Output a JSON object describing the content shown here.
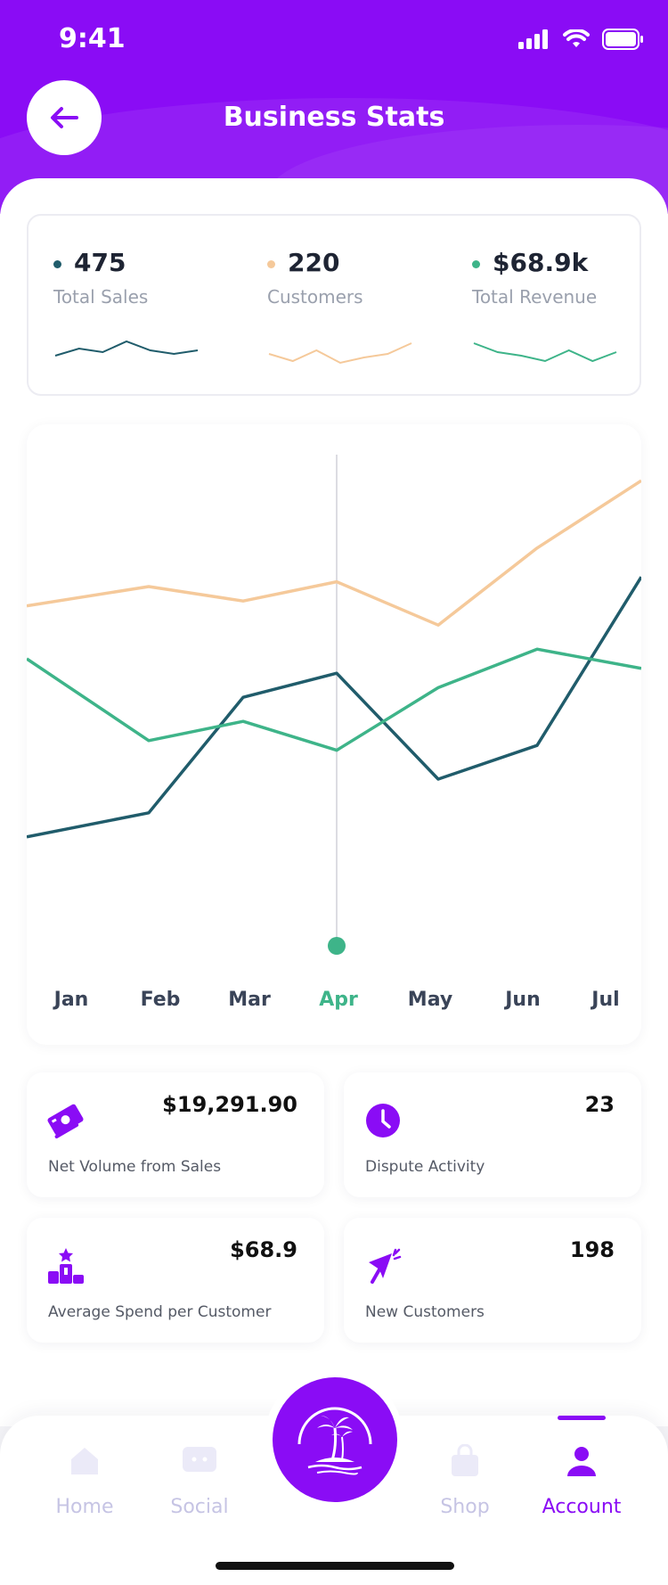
{
  "status_bar": {
    "time": "9:41"
  },
  "header": {
    "title": "Business Stats"
  },
  "summary": [
    {
      "value": "475",
      "label": "Total Sales",
      "color": "#205c6b",
      "spark": [
        10,
        18,
        14,
        26,
        16,
        12,
        16
      ]
    },
    {
      "value": "220",
      "label": "Customers",
      "color": "#f5c99a",
      "spark": [
        12,
        4,
        16,
        2,
        8,
        12,
        24
      ]
    },
    {
      "value": "$68.9k",
      "label": "Total Revenue",
      "color": "#3eb489",
      "spark": [
        24,
        14,
        10,
        4,
        16,
        4,
        14
      ]
    }
  ],
  "chart_data": {
    "type": "line",
    "categories": [
      "Jan",
      "Feb",
      "Mar",
      "Apr",
      "May",
      "Jun",
      "Jul"
    ],
    "selected": "Apr",
    "series": [
      {
        "color": "#f5c99a",
        "values": [
          66,
          70,
          67,
          71,
          62,
          78,
          92
        ]
      },
      {
        "color": "#205c6b",
        "values": [
          18,
          23,
          47,
          52,
          30,
          37,
          72
        ]
      },
      {
        "color": "#3eb489",
        "values": [
          55,
          38,
          42,
          36,
          49,
          57,
          53
        ]
      }
    ],
    "ylim": [
      0,
      100
    ],
    "colors": {
      "axis_label": "#3a4458",
      "selected_label": "#3eb489",
      "guide": "#dcdce2"
    }
  },
  "stats": [
    {
      "icon": "money-icon",
      "value": "$19,291.90",
      "label": "Net Volume from Sales"
    },
    {
      "icon": "clock-icon",
      "value": "23",
      "label": "Dispute Activity"
    },
    {
      "icon": "podium-icon",
      "value": "$68.9",
      "label": "Average Spend per Customer"
    },
    {
      "icon": "megaphone-icon",
      "value": "198",
      "label": "New Customers"
    }
  ],
  "tabbar": {
    "items": [
      {
        "label": "Home",
        "icon": "home-icon"
      },
      {
        "label": "Social",
        "icon": "chat-icon"
      },
      {
        "label": "Shop",
        "icon": "bag-icon"
      },
      {
        "label": "Account",
        "icon": "user-icon",
        "active": true
      }
    ],
    "center_icon": "palm-island-icon"
  },
  "colors": {
    "brand": "#8a0cf5"
  }
}
